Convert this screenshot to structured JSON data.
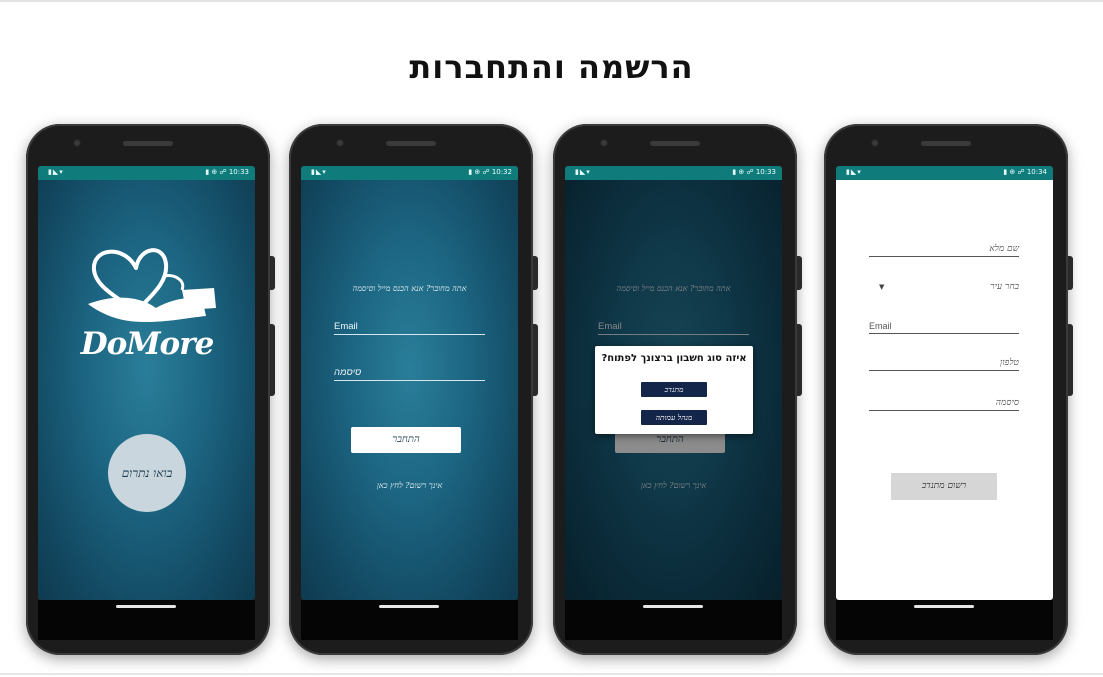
{
  "page": {
    "title": "הרשמה והתחברות"
  },
  "phones": [
    {
      "time": "10:33",
      "logo_text": "DoMore",
      "welcome_button": "בואו נתרום"
    },
    {
      "time": "10:32",
      "hint": "אתה מחובר? אנא הכנס מייל וסיסמה",
      "email_placeholder": "Email",
      "password_placeholder": "סיסמה",
      "login_button": "התחבר",
      "register_link": "אינך רשום? לחץ כאן"
    },
    {
      "time": "10:33",
      "hint": "אתה מחובר? אנא הכנס מייל וסיסמה",
      "email_placeholder": "Email",
      "login_button": "התחבר",
      "register_link": "אינך רשום? לחץ כאן",
      "dialog": {
        "title": "איזה סוג חשבון ברצונך לפתוח?",
        "option_1": "מתנדב",
        "option_2": "מנהל עמותה"
      }
    },
    {
      "time": "10:34",
      "full_name_placeholder": "שם מלא",
      "city_placeholder": "בחר עיר",
      "email_placeholder": "Email",
      "phone_placeholder": "טלפון",
      "password_placeholder": "סיסמה",
      "register_button": "רשום מתנדב"
    }
  ]
}
